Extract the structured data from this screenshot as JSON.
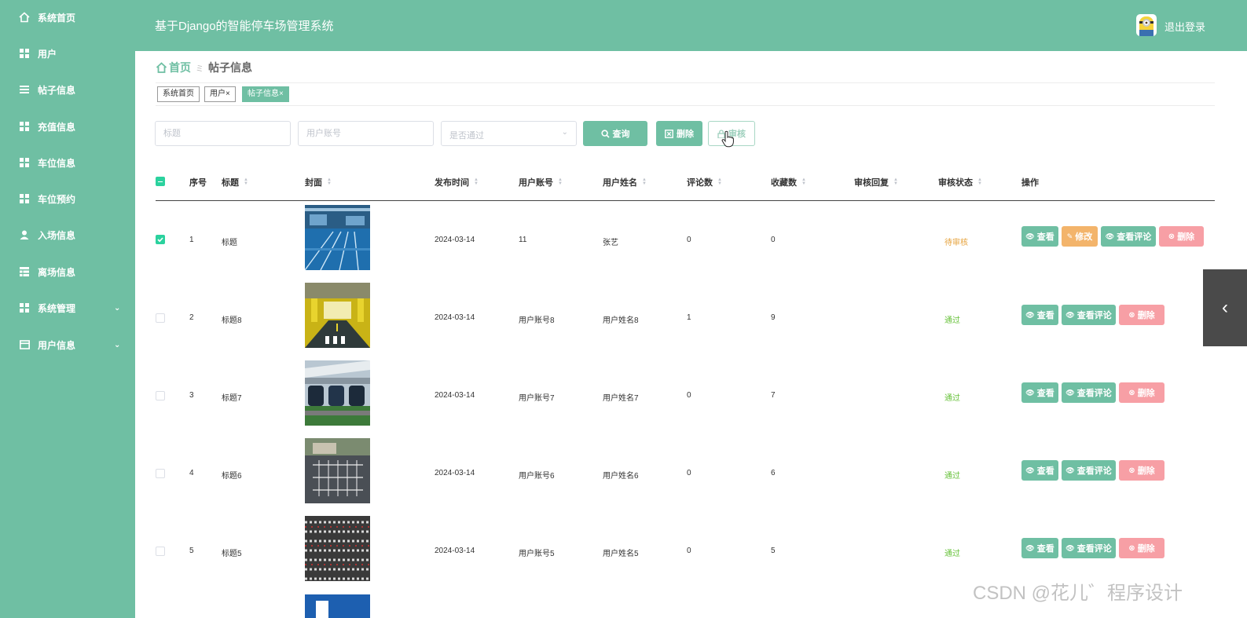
{
  "sidebar": {
    "items": [
      {
        "label": "系统首页",
        "icon": "home-icon"
      },
      {
        "label": "用户",
        "icon": "grid-icon"
      },
      {
        "label": "帖子信息",
        "icon": "list-icon"
      },
      {
        "label": "充值信息",
        "icon": "grid-icon"
      },
      {
        "label": "车位信息",
        "icon": "grid-icon"
      },
      {
        "label": "车位预约",
        "icon": "grid-icon"
      },
      {
        "label": "入场信息",
        "icon": "person-icon"
      },
      {
        "label": "离场信息",
        "icon": "table-icon"
      },
      {
        "label": "系统管理",
        "icon": "grid-icon"
      },
      {
        "label": "用户信息",
        "icon": "card-icon"
      }
    ]
  },
  "header": {
    "title": "基于Django的智能停车场管理系统",
    "logout_label": "退出登录"
  },
  "breadcrumb": {
    "home": "首页",
    "separator": "ミ",
    "current": "帖子信息"
  },
  "tags": [
    {
      "label": "系统首页"
    },
    {
      "label": "用户×"
    },
    {
      "label": "帖子信息×"
    }
  ],
  "search": {
    "title_placeholder": "标题",
    "account_placeholder": "用户账号",
    "pass_placeholder": "是否通过",
    "query_label": "查询",
    "delete_label": "删除",
    "audit_label": "审核"
  },
  "table": {
    "headers": [
      "序号",
      "标题",
      "封面",
      "发布时间",
      "用户账号",
      "用户姓名",
      "评论数",
      "收藏数",
      "审核回复",
      "审核状态",
      "操作"
    ],
    "rows": [
      {
        "index": "1",
        "title": "标题",
        "date": "2024-03-14",
        "account": "11",
        "name": "张艺",
        "comments": "0",
        "favorites": "0",
        "status": "待审核",
        "checked": true,
        "editable": true
      },
      {
        "index": "2",
        "title": "标题8",
        "date": "2024-03-14",
        "account": "用户账号8",
        "name": "用户姓名8",
        "comments": "1",
        "favorites": "9",
        "status": "通过",
        "checked": false,
        "editable": false
      },
      {
        "index": "3",
        "title": "标题7",
        "date": "2024-03-14",
        "account": "用户账号7",
        "name": "用户姓名7",
        "comments": "0",
        "favorites": "7",
        "status": "通过",
        "checked": false,
        "editable": false
      },
      {
        "index": "4",
        "title": "标题6",
        "date": "2024-03-14",
        "account": "用户账号6",
        "name": "用户姓名6",
        "comments": "0",
        "favorites": "6",
        "status": "通过",
        "checked": false,
        "editable": false
      },
      {
        "index": "5",
        "title": "标题5",
        "date": "2024-03-14",
        "account": "用户账号5",
        "name": "用户姓名5",
        "comments": "0",
        "favorites": "5",
        "status": "通过",
        "checked": false,
        "editable": false
      }
    ],
    "actions": {
      "view": "查看",
      "edit": "修改",
      "view_comments": "查看评论",
      "delete": "删除"
    }
  },
  "colors": {
    "primary": "#6fbfa3",
    "edit": "#f3b46b",
    "delete": "#f79fa5",
    "pending": "#e6a23c",
    "passed": "#67c23a"
  },
  "watermark": "CSDN @花儿゛程序设计"
}
